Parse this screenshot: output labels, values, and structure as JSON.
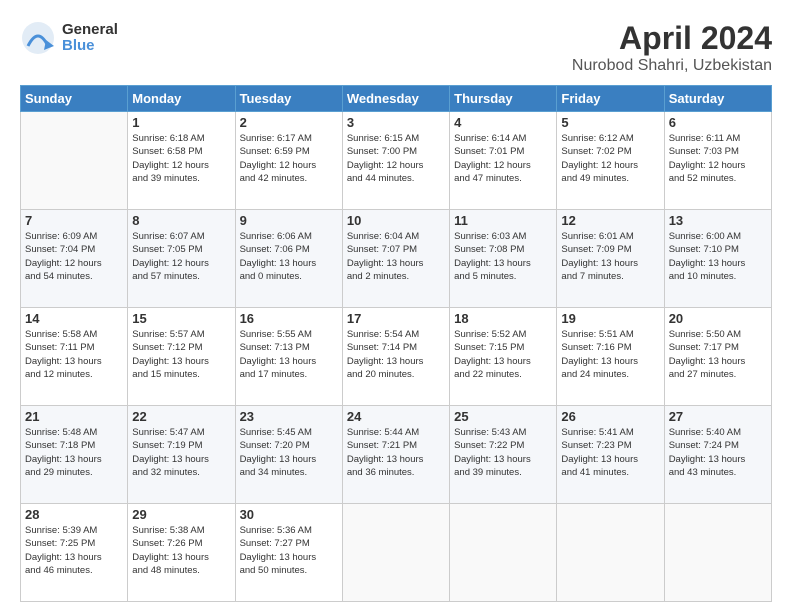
{
  "logo": {
    "line1": "General",
    "line2": "Blue"
  },
  "title": "April 2024",
  "location": "Nurobod Shahri, Uzbekistan",
  "weekdays": [
    "Sunday",
    "Monday",
    "Tuesday",
    "Wednesday",
    "Thursday",
    "Friday",
    "Saturday"
  ],
  "weeks": [
    [
      null,
      {
        "day": 1,
        "sunrise": "6:18 AM",
        "sunset": "6:58 PM",
        "daylight": "12 hours and 39 minutes."
      },
      {
        "day": 2,
        "sunrise": "6:17 AM",
        "sunset": "6:59 PM",
        "daylight": "12 hours and 42 minutes."
      },
      {
        "day": 3,
        "sunrise": "6:15 AM",
        "sunset": "7:00 PM",
        "daylight": "12 hours and 44 minutes."
      },
      {
        "day": 4,
        "sunrise": "6:14 AM",
        "sunset": "7:01 PM",
        "daylight": "12 hours and 47 minutes."
      },
      {
        "day": 5,
        "sunrise": "6:12 AM",
        "sunset": "7:02 PM",
        "daylight": "12 hours and 49 minutes."
      },
      {
        "day": 6,
        "sunrise": "6:11 AM",
        "sunset": "7:03 PM",
        "daylight": "12 hours and 52 minutes."
      }
    ],
    [
      {
        "day": 7,
        "sunrise": "6:09 AM",
        "sunset": "7:04 PM",
        "daylight": "12 hours and 54 minutes."
      },
      {
        "day": 8,
        "sunrise": "6:07 AM",
        "sunset": "7:05 PM",
        "daylight": "12 hours and 57 minutes."
      },
      {
        "day": 9,
        "sunrise": "6:06 AM",
        "sunset": "7:06 PM",
        "daylight": "13 hours and 0 minutes."
      },
      {
        "day": 10,
        "sunrise": "6:04 AM",
        "sunset": "7:07 PM",
        "daylight": "13 hours and 2 minutes."
      },
      {
        "day": 11,
        "sunrise": "6:03 AM",
        "sunset": "7:08 PM",
        "daylight": "13 hours and 5 minutes."
      },
      {
        "day": 12,
        "sunrise": "6:01 AM",
        "sunset": "7:09 PM",
        "daylight": "13 hours and 7 minutes."
      },
      {
        "day": 13,
        "sunrise": "6:00 AM",
        "sunset": "7:10 PM",
        "daylight": "13 hours and 10 minutes."
      }
    ],
    [
      {
        "day": 14,
        "sunrise": "5:58 AM",
        "sunset": "7:11 PM",
        "daylight": "13 hours and 12 minutes."
      },
      {
        "day": 15,
        "sunrise": "5:57 AM",
        "sunset": "7:12 PM",
        "daylight": "13 hours and 15 minutes."
      },
      {
        "day": 16,
        "sunrise": "5:55 AM",
        "sunset": "7:13 PM",
        "daylight": "13 hours and 17 minutes."
      },
      {
        "day": 17,
        "sunrise": "5:54 AM",
        "sunset": "7:14 PM",
        "daylight": "13 hours and 20 minutes."
      },
      {
        "day": 18,
        "sunrise": "5:52 AM",
        "sunset": "7:15 PM",
        "daylight": "13 hours and 22 minutes."
      },
      {
        "day": 19,
        "sunrise": "5:51 AM",
        "sunset": "7:16 PM",
        "daylight": "13 hours and 24 minutes."
      },
      {
        "day": 20,
        "sunrise": "5:50 AM",
        "sunset": "7:17 PM",
        "daylight": "13 hours and 27 minutes."
      }
    ],
    [
      {
        "day": 21,
        "sunrise": "5:48 AM",
        "sunset": "7:18 PM",
        "daylight": "13 hours and 29 minutes."
      },
      {
        "day": 22,
        "sunrise": "5:47 AM",
        "sunset": "7:19 PM",
        "daylight": "13 hours and 32 minutes."
      },
      {
        "day": 23,
        "sunrise": "5:45 AM",
        "sunset": "7:20 PM",
        "daylight": "13 hours and 34 minutes."
      },
      {
        "day": 24,
        "sunrise": "5:44 AM",
        "sunset": "7:21 PM",
        "daylight": "13 hours and 36 minutes."
      },
      {
        "day": 25,
        "sunrise": "5:43 AM",
        "sunset": "7:22 PM",
        "daylight": "13 hours and 39 minutes."
      },
      {
        "day": 26,
        "sunrise": "5:41 AM",
        "sunset": "7:23 PM",
        "daylight": "13 hours and 41 minutes."
      },
      {
        "day": 27,
        "sunrise": "5:40 AM",
        "sunset": "7:24 PM",
        "daylight": "13 hours and 43 minutes."
      }
    ],
    [
      {
        "day": 28,
        "sunrise": "5:39 AM",
        "sunset": "7:25 PM",
        "daylight": "13 hours and 46 minutes."
      },
      {
        "day": 29,
        "sunrise": "5:38 AM",
        "sunset": "7:26 PM",
        "daylight": "13 hours and 48 minutes."
      },
      {
        "day": 30,
        "sunrise": "5:36 AM",
        "sunset": "7:27 PM",
        "daylight": "13 hours and 50 minutes."
      },
      null,
      null,
      null,
      null
    ]
  ]
}
